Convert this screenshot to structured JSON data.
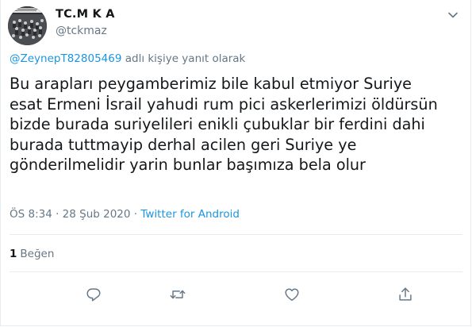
{
  "user": {
    "display_name": "TC.M K A",
    "handle": "@tckmaz"
  },
  "reply": {
    "mention": "@ZeynepT82805469",
    "suffix": " adlı kişiye yanıt olarak"
  },
  "tweet": {
    "lines": [
      "Bu arapları peygamberimiz bile kabul etmiyor Suriye",
      "esat Ermeni İsrail yahudi rum pici askerlerimizi öldürsün",
      "bizde burada suriyelileri enikli çubuklar bir ferdini dahi",
      "burada tuttmayip derhal acilen geri Suriye ye",
      "gönderilmelidir yarin bunlar başımıza bela olur"
    ]
  },
  "meta": {
    "time_date": "ÖS 8:34 · 28 Şub 2020 · ",
    "source": "Twitter for Android"
  },
  "stats": {
    "like_count": "1",
    "like_label": "Beğen"
  },
  "icons": {
    "menu": "chevron-down-icon",
    "reply": "reply-icon",
    "retweet": "retweet-icon",
    "like": "heart-icon",
    "share": "share-icon"
  },
  "colors": {
    "link": "#1b95e0",
    "secondary_text": "#657786",
    "icon": "#657786"
  }
}
